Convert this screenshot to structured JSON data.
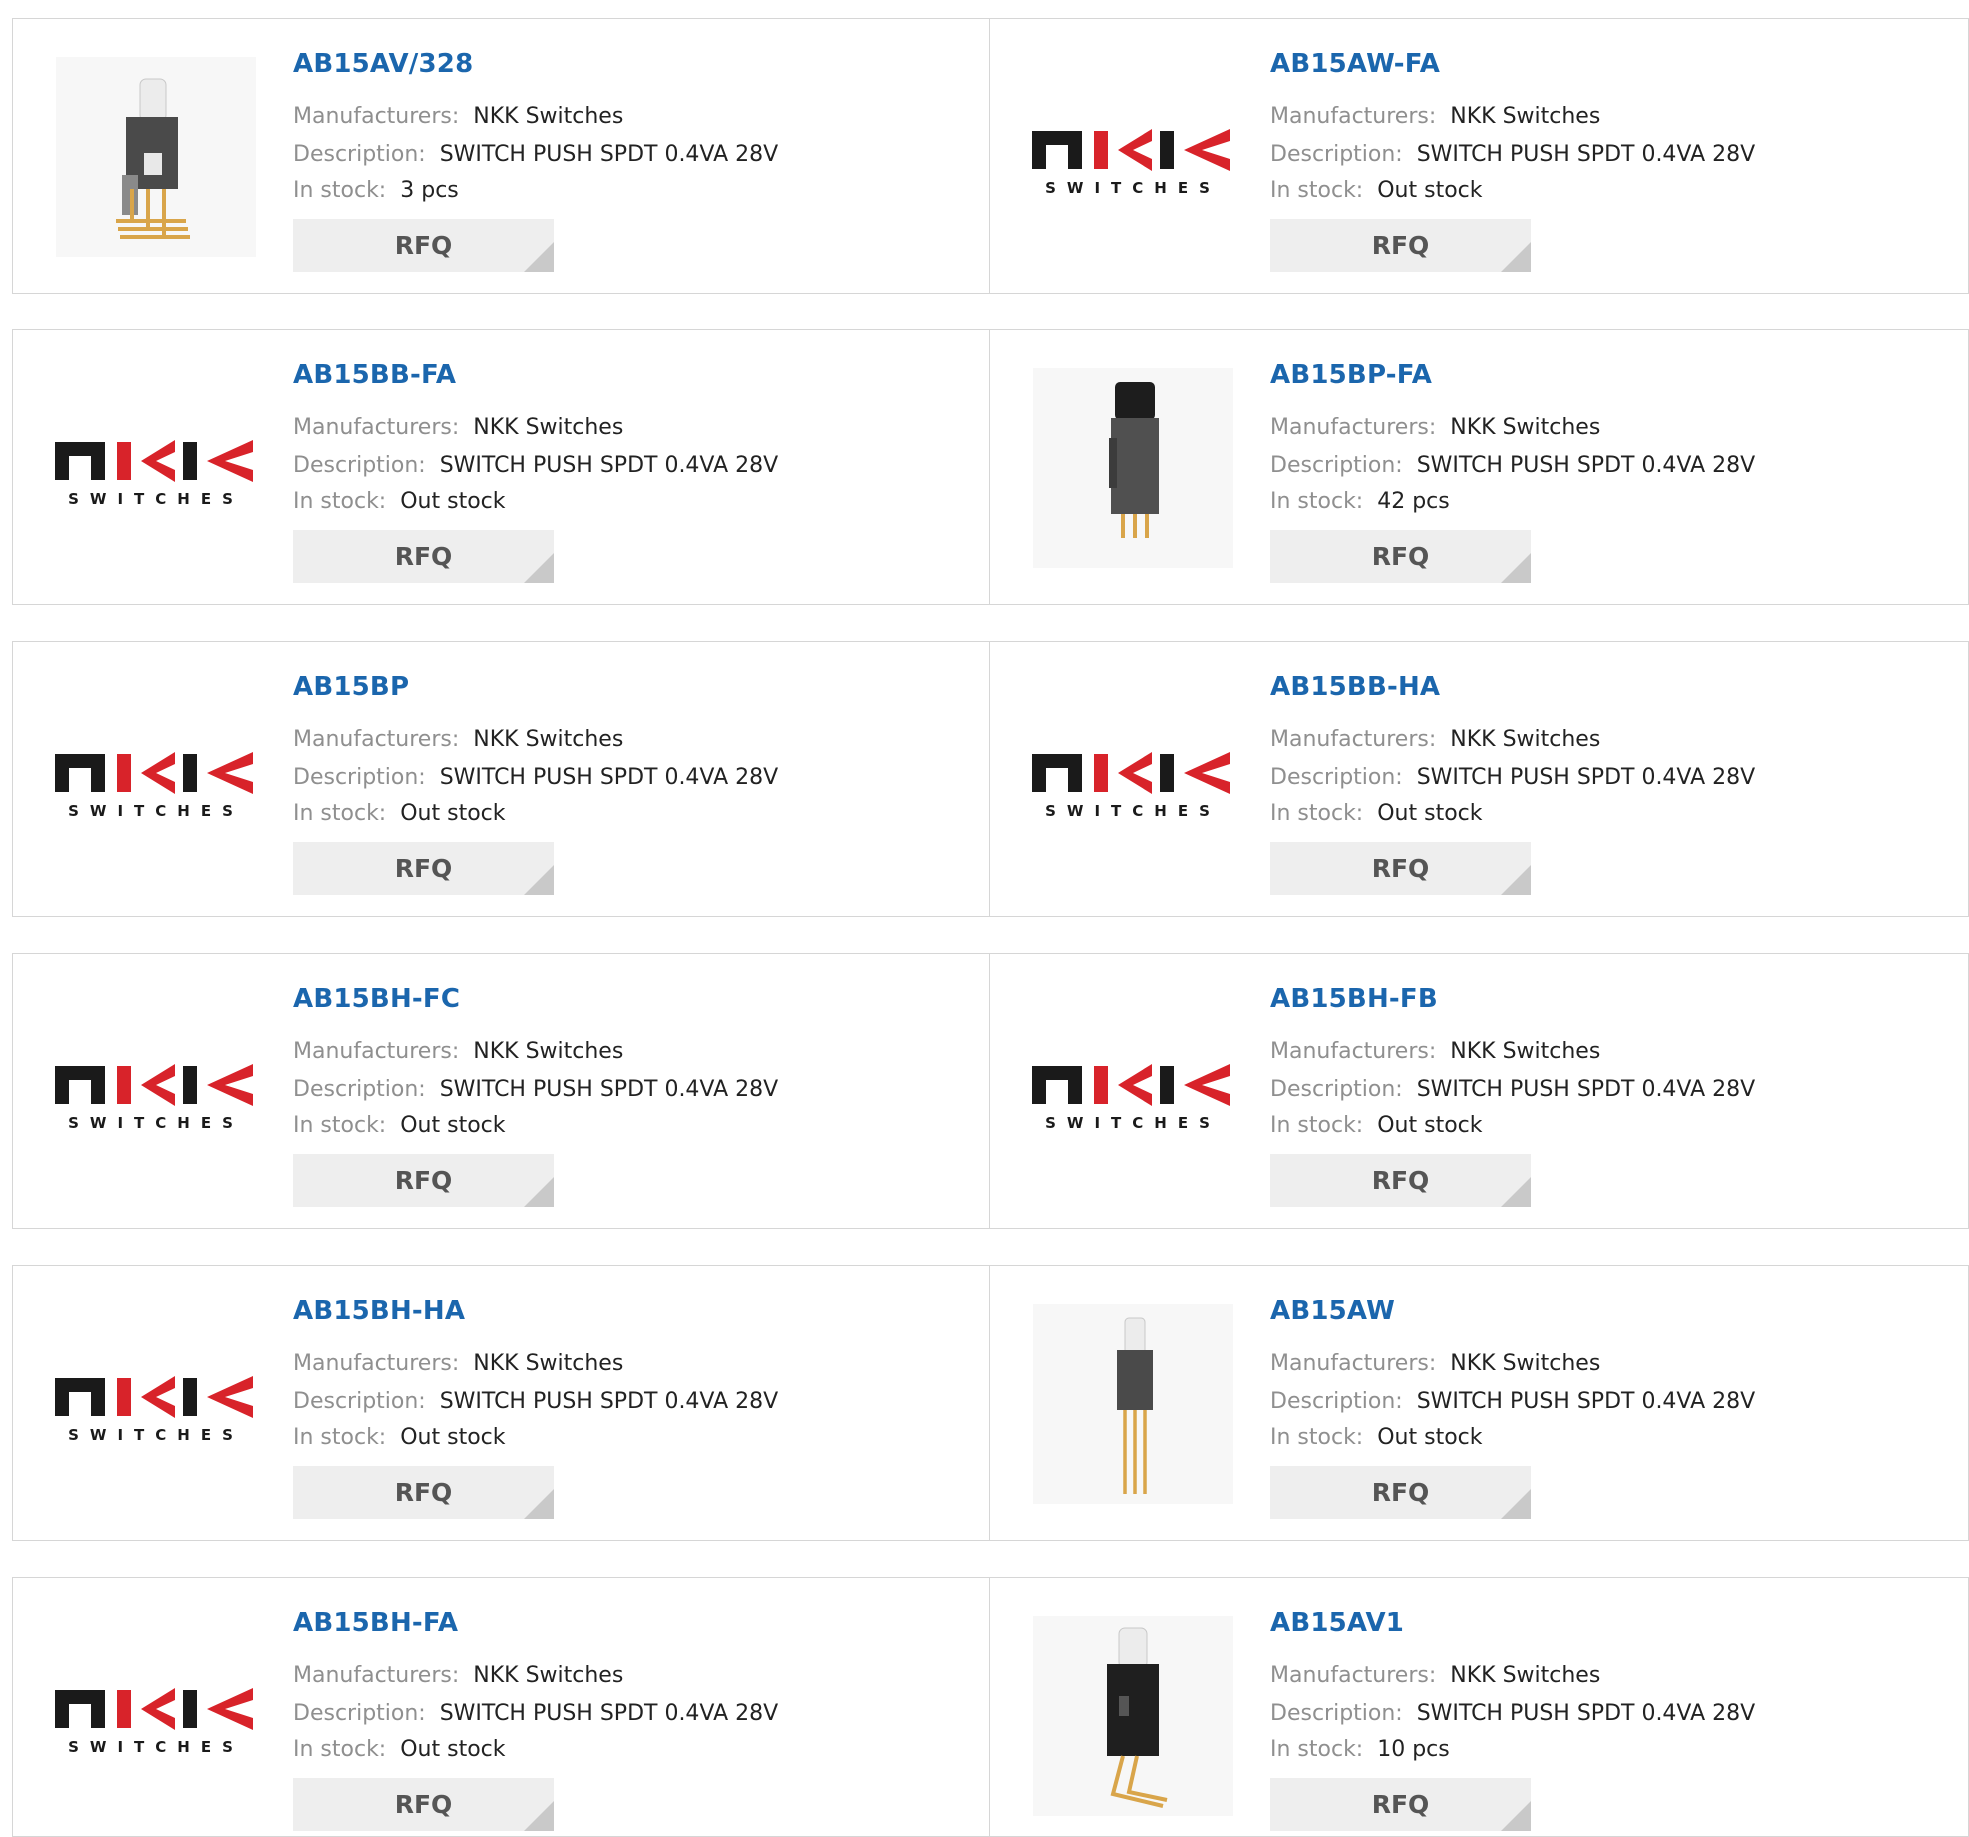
{
  "labels": {
    "manufacturers": "Manufacturers:",
    "description": "Description:",
    "stock": "In stock:",
    "rfq": "RFQ"
  },
  "logo": {
    "brand": "nKK",
    "sub": "SWITCHES"
  },
  "colors": {
    "title": "#1b66ad",
    "brand_red": "#d8232a",
    "brand_black": "#1a1a1a",
    "button_bg": "#eeeeee"
  },
  "products": [
    {
      "part": "AB15AV/328",
      "manufacturer": "NKK Switches",
      "description": "SWITCH PUSH SPDT 0.4VA 28V",
      "stock": "3 pcs",
      "image": "right-angle-switch-photo"
    },
    {
      "part": "AB15AW-FA",
      "manufacturer": "NKK Switches",
      "description": "SWITCH PUSH SPDT 0.4VA 28V",
      "stock": "Out stock",
      "image": "nkk-logo"
    },
    {
      "part": "AB15BB-FA",
      "manufacturer": "NKK Switches",
      "description": "SWITCH PUSH SPDT 0.4VA 28V",
      "stock": "Out stock",
      "image": "nkk-logo"
    },
    {
      "part": "AB15BP-FA",
      "manufacturer": "NKK Switches",
      "description": "SWITCH PUSH SPDT 0.4VA 28V",
      "stock": "42 pcs",
      "image": "black-cap-switch-photo"
    },
    {
      "part": "AB15BP",
      "manufacturer": "NKK Switches",
      "description": "SWITCH PUSH SPDT 0.4VA 28V",
      "stock": "Out stock",
      "image": "nkk-logo"
    },
    {
      "part": "AB15BB-HA",
      "manufacturer": "NKK Switches",
      "description": "SWITCH PUSH SPDT 0.4VA 28V",
      "stock": "Out stock",
      "image": "nkk-logo"
    },
    {
      "part": "AB15BH-FC",
      "manufacturer": "NKK Switches",
      "description": "SWITCH PUSH SPDT 0.4VA 28V",
      "stock": "Out stock",
      "image": "nkk-logo"
    },
    {
      "part": "AB15BH-FB",
      "manufacturer": "NKK Switches",
      "description": "SWITCH PUSH SPDT 0.4VA 28V",
      "stock": "Out stock",
      "image": "nkk-logo"
    },
    {
      "part": "AB15BH-HA",
      "manufacturer": "NKK Switches",
      "description": "SWITCH PUSH SPDT 0.4VA 28V",
      "stock": "Out stock",
      "image": "nkk-logo"
    },
    {
      "part": "AB15AW",
      "manufacturer": "NKK Switches",
      "description": "SWITCH PUSH SPDT 0.4VA 28V",
      "stock": "Out stock",
      "image": "long-pin-switch-photo"
    },
    {
      "part": "AB15BH-FA",
      "manufacturer": "NKK Switches",
      "description": "SWITCH PUSH SPDT 0.4VA 28V",
      "stock": "Out stock",
      "image": "nkk-logo"
    },
    {
      "part": "AB15AV1",
      "manufacturer": "NKK Switches",
      "description": "SWITCH PUSH SPDT 0.4VA 28V",
      "stock": "10 pcs",
      "image": "angled-lead-switch-photo"
    }
  ]
}
